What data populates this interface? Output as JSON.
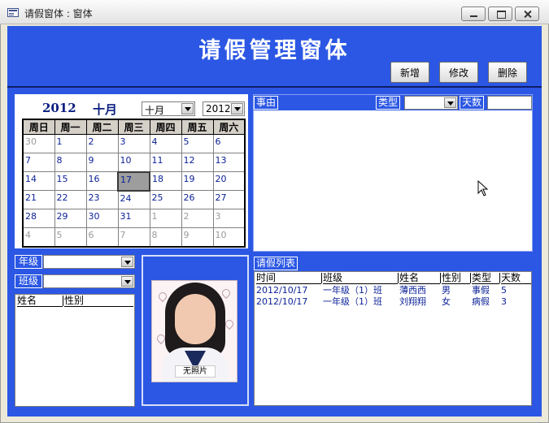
{
  "window": {
    "title": "请假窗体 : 窗体"
  },
  "form": {
    "title": "请假管理窗体"
  },
  "toolbar": {
    "add_label": "新增",
    "edit_label": "修改",
    "delete_label": "删除"
  },
  "calendar": {
    "year_text": "2012",
    "month_text": "十月",
    "month_combo": "十月",
    "year_combo": "2012",
    "weekdays": [
      "周日",
      "周一",
      "周二",
      "周三",
      "周四",
      "周五",
      "周六"
    ],
    "weeks": [
      [
        "30",
        "1",
        "2",
        "3",
        "4",
        "5",
        "6"
      ],
      [
        "7",
        "8",
        "9",
        "10",
        "11",
        "12",
        "13"
      ],
      [
        "14",
        "15",
        "16",
        "17",
        "18",
        "19",
        "20"
      ],
      [
        "21",
        "22",
        "23",
        "24",
        "25",
        "26",
        "27"
      ],
      [
        "28",
        "29",
        "30",
        "31",
        "1",
        "2",
        "3"
      ],
      [
        "4",
        "5",
        "6",
        "7",
        "8",
        "9",
        "10"
      ]
    ],
    "selected_day": "17"
  },
  "reason": {
    "label": "事由",
    "type_label": "类型",
    "days_label": "天数"
  },
  "filter": {
    "grade_label": "年级",
    "class_label": "班级"
  },
  "student_list": {
    "col_name": "姓名",
    "col_gender": "性别"
  },
  "photo": {
    "caption": "无照片"
  },
  "leave_list": {
    "title": "请假列表",
    "columns": [
      "时间",
      "班级",
      "姓名",
      "性别",
      "类型",
      "天数"
    ],
    "rows": [
      [
        "2012/10/17",
        "一年级（1）班",
        "薄西西",
        "男",
        "事假",
        "5"
      ],
      [
        "2012/10/17",
        "一年级（1）班",
        "刘翔翔",
        "女",
        "病假",
        "3"
      ]
    ]
  },
  "colors": {
    "form_bg": "#2b57e4",
    "header_rule": "#0d1e66",
    "calendar_text": "#0b1f82"
  }
}
